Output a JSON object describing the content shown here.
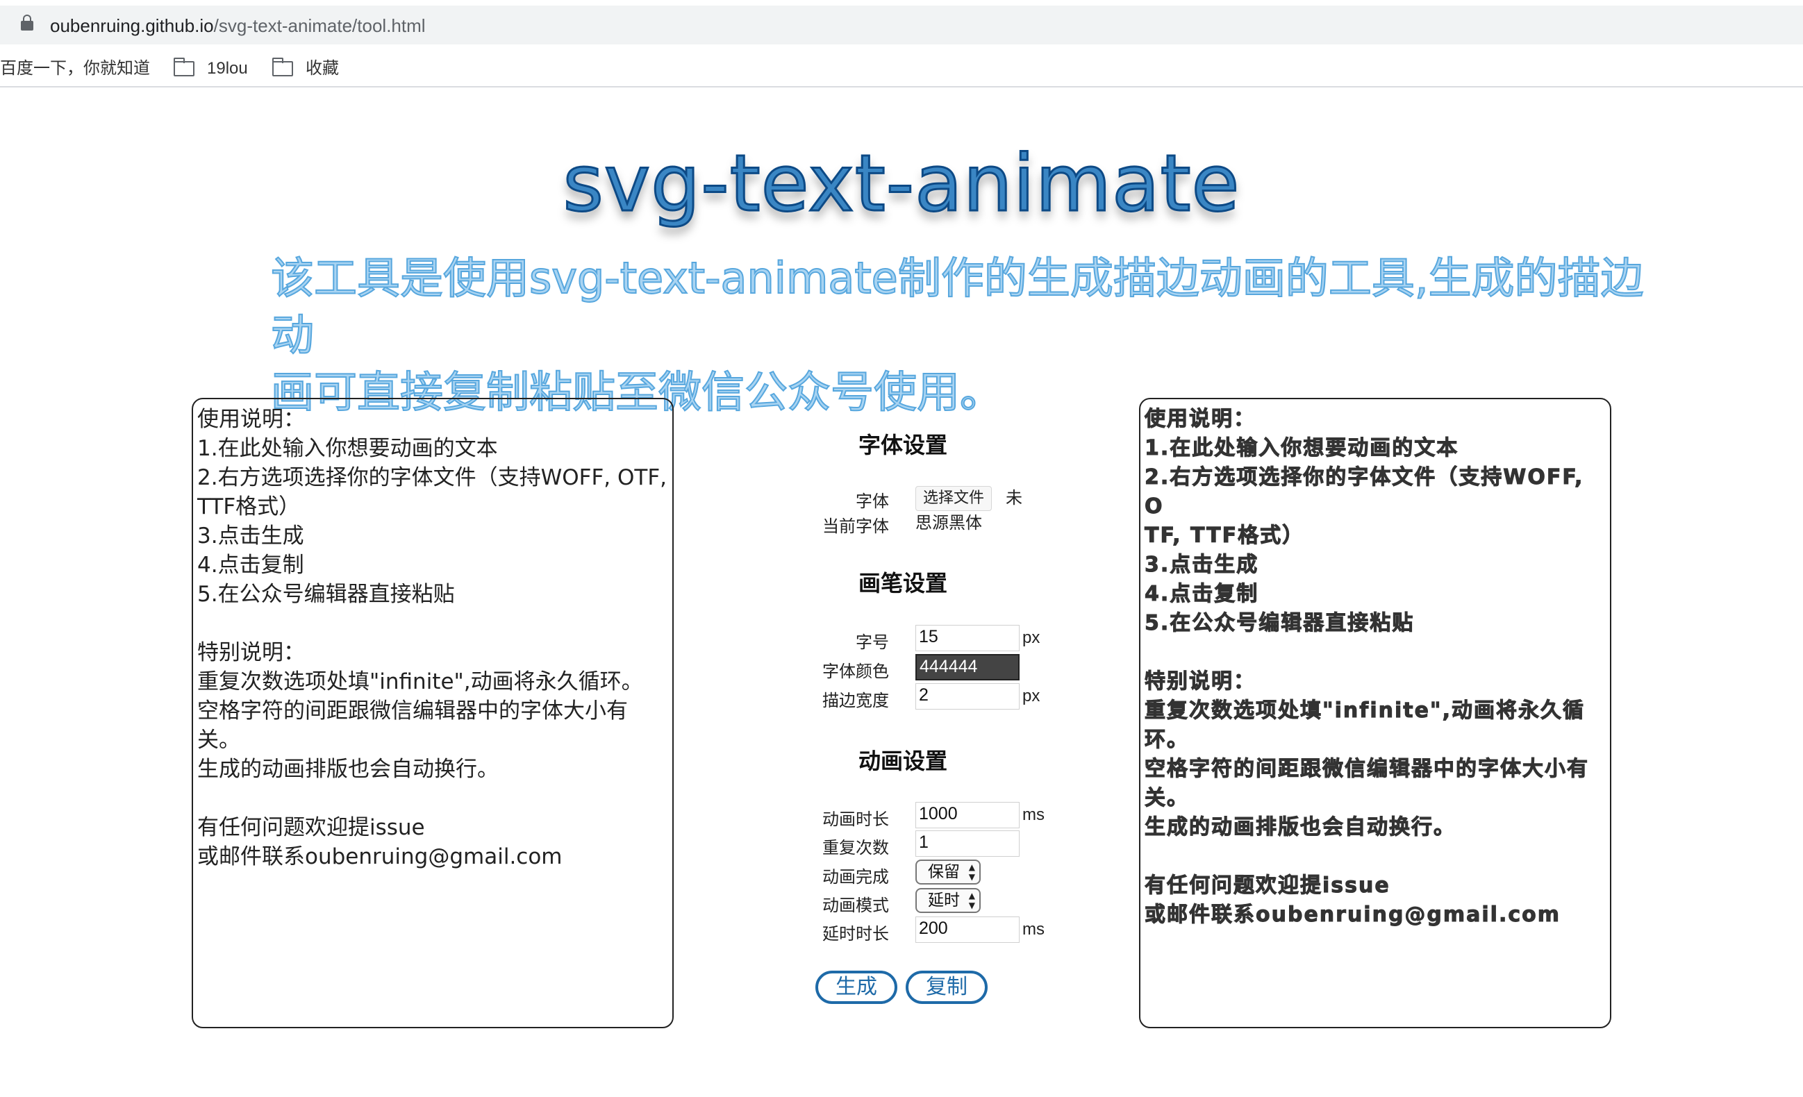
{
  "browser": {
    "url_host": "oubenruing.github.io",
    "url_path": "/svg-text-animate/tool.html",
    "bookmarks": [
      "百度一下，你就知道",
      "19lou",
      "收藏"
    ]
  },
  "page": {
    "title": "svg-text-animate",
    "subtitle_line1": "该工具是使用svg-text-animate制作的生成描边动画的工具,生成的描边动",
    "subtitle_line2": "画可直接复制粘贴至微信公众号使用。",
    "input_text": "使用说明：\n1.在此处输入你想要动画的文本\n2.右方选项选择你的字体文件（支持WOFF, OTF,\nTTF格式）\n3.点击生成\n4.点击复制\n5.在公众号编辑器直接粘贴\n\n特别说明：\n重复次数选项处填\"infinite\",动画将永久循环。\n空格字符的间距跟微信编辑器中的字体大小有关。\n生成的动画排版也会自动换行。\n\n有任何问题欢迎提issue\n或邮件联系oubenruing@gmail.com",
    "preview_text": "使用说明：\n1.在此处输入你想要动画的文本\n2.右方选项选择你的字体文件（支持WOFF, O\nTF, TTF格式）\n3.点击生成\n4.点击复制\n5.在公众号编辑器直接粘贴\n\n特别说明：\n重复次数选项处填\"infinite\",动画将永久循环。\n空格字符的间距跟微信编辑器中的字体大小有\n关。\n生成的动画排版也会自动换行。\n\n有任何问题欢迎提issue\n或邮件联系oubenruing@gmail.com"
  },
  "font_settings": {
    "title": "字体设置",
    "font_label": "字体",
    "file_button": "选择文件",
    "file_status": "未",
    "current_font_label": "当前字体",
    "current_font_value": "思源黑体"
  },
  "pen_settings": {
    "title": "画笔设置",
    "size_label": "字号",
    "size_value": "15",
    "size_unit": "px",
    "color_label": "字体颜色",
    "color_value": "444444",
    "stroke_label": "描边宽度",
    "stroke_value": "2",
    "stroke_unit": "px"
  },
  "anim_settings": {
    "title": "动画设置",
    "duration_label": "动画时长",
    "duration_value": "1000",
    "duration_unit": "ms",
    "repeat_label": "重复次数",
    "repeat_value": "1",
    "finish_label": "动画完成",
    "finish_value": "保留",
    "mode_label": "动画模式",
    "mode_value": "延时",
    "delay_label": "延时时长",
    "delay_value": "200",
    "delay_unit": "ms"
  },
  "actions": {
    "generate": "生成",
    "copy": "复制"
  },
  "colors": {
    "title_fill": "#3a86c4",
    "title_stroke": "#0d4a86",
    "subtitle_fill": "#a9d4f2",
    "button_border": "#1e6aa8",
    "color_swatch": "#444444"
  }
}
